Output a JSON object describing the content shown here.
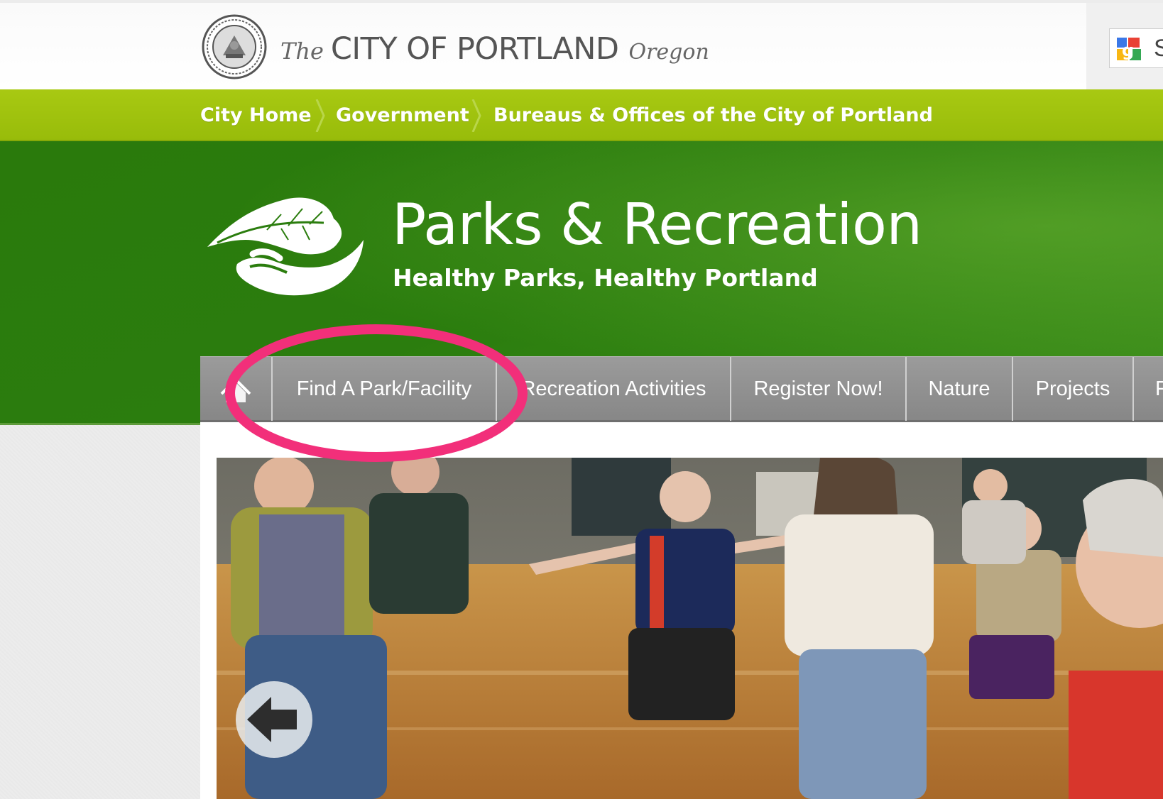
{
  "header": {
    "city_prefix": "The",
    "city_name": "CITY OF PORTLAND",
    "state": "Oregon",
    "search_label": "S"
  },
  "breadcrumb": [
    {
      "label": "City Home"
    },
    {
      "label": "Government"
    },
    {
      "label": "Bureaus & Offices of the City of Portland"
    }
  ],
  "site": {
    "title": "Parks & Recreation",
    "tagline": "Healthy Parks, Healthy Portland"
  },
  "nav": {
    "home_icon": "home-icon",
    "items": [
      {
        "label": "Find A Park/Facility"
      },
      {
        "label": "Recreation Activities"
      },
      {
        "label": "Register Now!"
      },
      {
        "label": "Nature"
      },
      {
        "label": "Projects"
      },
      {
        "label": "F"
      }
    ]
  },
  "slideshow": {
    "prev_icon": "arrow-left-icon"
  },
  "colors": {
    "breadcrumb_green": "#9fc40e",
    "header_green": "#2b7d0e",
    "nav_gray": "#919191",
    "highlight_pink": "#f22f7a"
  }
}
